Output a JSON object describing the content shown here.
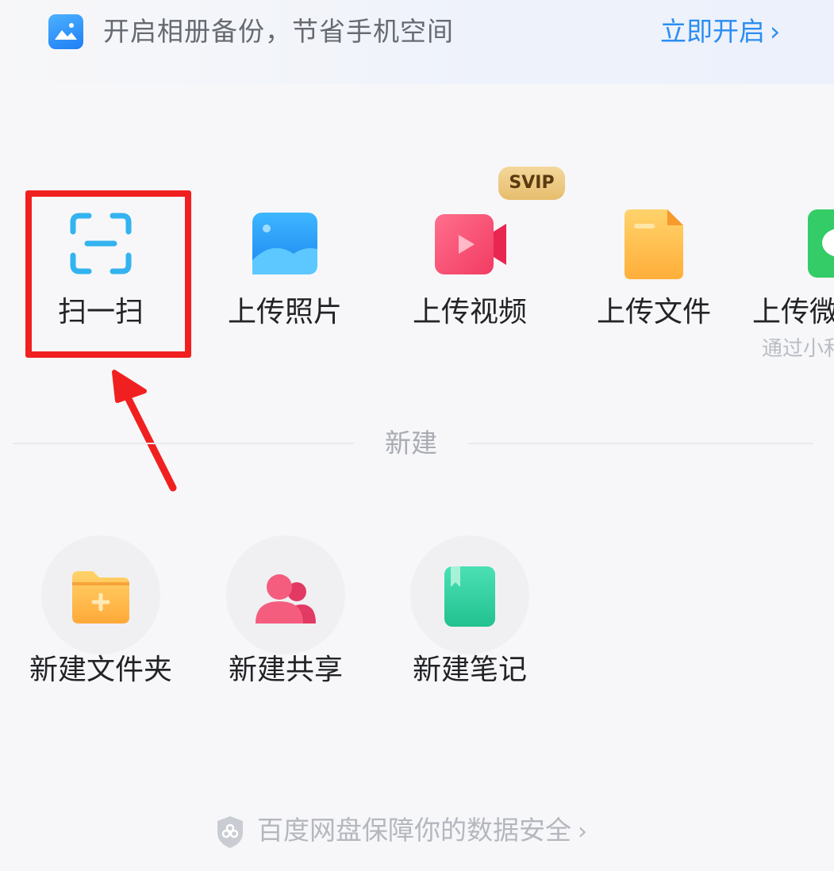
{
  "banner": {
    "text": "开启相册备份，节省手机空间",
    "action": "立即开启",
    "action_arrow": "›",
    "icon": "photo-album-icon"
  },
  "upload": {
    "badge": "SVIP",
    "items": [
      {
        "label": "扫一扫",
        "icon": "scan-icon"
      },
      {
        "label": "上传照片",
        "icon": "photo-icon"
      },
      {
        "label": "上传视频",
        "icon": "video-icon"
      },
      {
        "label": "上传文件",
        "icon": "file-icon"
      },
      {
        "label": "上传微",
        "sub": "通过小和",
        "icon": "wechat-icon"
      }
    ]
  },
  "new_section": {
    "title": "新建",
    "items": [
      {
        "label": "新建文件夹",
        "icon": "new-folder-icon"
      },
      {
        "label": "新建共享",
        "icon": "share-people-icon"
      },
      {
        "label": "新建笔记",
        "icon": "note-icon"
      }
    ]
  },
  "footer": {
    "text": "百度网盘保障你的数据安全",
    "arrow": "›",
    "icon": "shield-icon"
  },
  "colors": {
    "accent_blue": "#2b8df2",
    "highlight_red": "#f02020",
    "svip_gold": "#e7bd6d"
  }
}
